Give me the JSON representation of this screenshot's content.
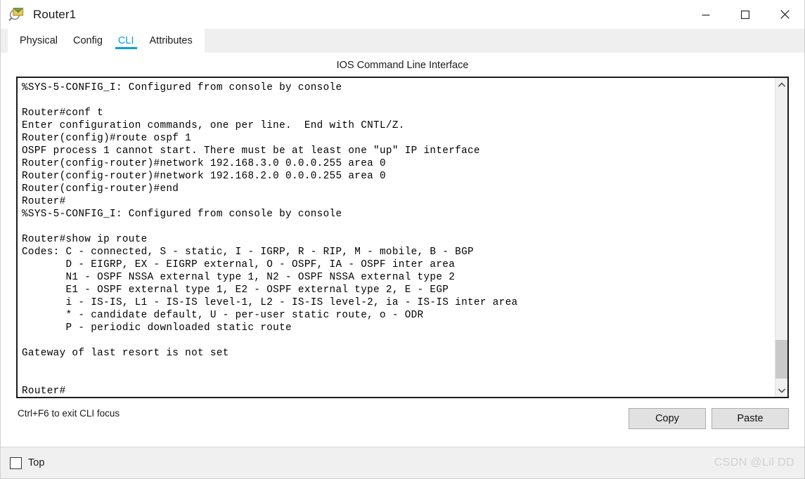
{
  "window": {
    "title": "Router1",
    "icon": "packet-tracer-magnifier-icon",
    "controls": {
      "minimize": "minimize-icon",
      "maximize": "maximize-icon",
      "close": "close-icon"
    }
  },
  "tabs": [
    {
      "label": "Physical",
      "active": false
    },
    {
      "label": "Config",
      "active": false
    },
    {
      "label": "CLI",
      "active": true
    },
    {
      "label": "Attributes",
      "active": false
    }
  ],
  "cli": {
    "header": "IOS Command Line Interface",
    "lines": [
      "%SYS-5-CONFIG_I: Configured from console by console",
      "",
      "Router#conf t",
      "Enter configuration commands, one per line.  End with CNTL/Z.",
      "Router(config)#route ospf 1",
      "OSPF process 1 cannot start. There must be at least one \"up\" IP interface",
      "Router(config-router)#network 192.168.3.0 0.0.0.255 area 0",
      "Router(config-router)#network 192.168.2.0 0.0.0.255 area 0",
      "Router(config-router)#end",
      "Router#",
      "%SYS-5-CONFIG_I: Configured from console by console",
      "",
      "Router#show ip route",
      "Codes: C - connected, S - static, I - IGRP, R - RIP, M - mobile, B - BGP",
      "       D - EIGRP, EX - EIGRP external, O - OSPF, IA - OSPF inter area",
      "       N1 - OSPF NSSA external type 1, N2 - OSPF NSSA external type 2",
      "       E1 - OSPF external type 1, E2 - OSPF external type 2, E - EGP",
      "       i - IS-IS, L1 - IS-IS level-1, L2 - IS-IS level-2, ia - IS-IS inter area",
      "       * - candidate default, U - per-user static route, o - ODR",
      "       P - periodic downloaded static route",
      "",
      "Gateway of last resort is not set",
      "",
      "",
      "Router#"
    ],
    "scrollbar": {
      "up_arrow": "chevron-up-icon",
      "down_arrow": "chevron-down-icon",
      "thumb_top_percent": 85,
      "thumb_height_percent": 13
    }
  },
  "footer": {
    "hint": "Ctrl+F6 to exit CLI focus",
    "copy_label": "Copy",
    "paste_label": "Paste"
  },
  "statusbar": {
    "top_checkbox_label": "Top",
    "top_checked": false,
    "watermark": "CSDN @Lil DD"
  },
  "colors": {
    "accent": "#00a0e0",
    "tab_bar_bg": "#efefef",
    "terminal_bg": "#ffffff",
    "terminal_fg": "#000000",
    "button_bg": "#e1e1e1",
    "status_bg": "#f0f0f0"
  }
}
